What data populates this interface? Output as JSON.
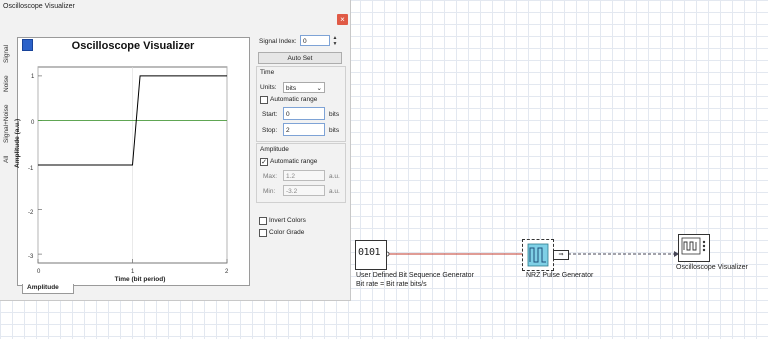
{
  "window": {
    "title": "Oscilloscope Visualizer",
    "close_glyph": "×"
  },
  "plot": {
    "title": "Oscilloscope Visualizer",
    "ylabel": "Amplitude (a.u.)",
    "xlabel": "Time (bit period)",
    "side_tabs": [
      "Signal",
      "Noise",
      "Signal+Noise",
      "All"
    ],
    "bottom_tab": "Amplitude",
    "yticks": [
      "1",
      "0",
      "-1",
      "-2",
      "-3"
    ],
    "xticks": [
      "0",
      "1",
      "2"
    ]
  },
  "chart_data": {
    "type": "line",
    "x": [
      0,
      1.0,
      1.08,
      2
    ],
    "y": [
      -1,
      -1,
      1,
      1
    ],
    "ylim": [
      -3.2,
      1.2
    ],
    "xlim": [
      0,
      2
    ],
    "title": "Oscilloscope Visualizer",
    "xlabel": "Time (bit period)",
    "ylabel": "Amplitude (a.u.)",
    "color": "#000000",
    "zero_line_color": "#4a9a3c"
  },
  "controls": {
    "signal_index_label": "Signal Index:",
    "signal_index_value": "0",
    "auto_set_label": "Auto Set",
    "time_group": "Time",
    "units_label": "Units:",
    "units_value": "bits",
    "automatic_range_label": "Automatic range",
    "start_label": "Start:",
    "start_value": "0",
    "start_unit": "bits",
    "stop_label": "Stop:",
    "stop_value": "2",
    "stop_unit": "bits",
    "amplitude_group": "Amplitude",
    "amp_automatic_range_label": "Automatic range",
    "max_label": "Max:",
    "max_value": "1.2",
    "max_unit": "a.u.",
    "min_label": "Min:",
    "min_value": "-3.2",
    "min_unit": "a.u.",
    "invert_colors_label": "Invert Colors",
    "color_grade_label": "Color Grade"
  },
  "canvas": {
    "bit_gen": {
      "label": "User Defined Bit Sequence Generator",
      "sub": "Bit rate = Bit rate  bits/s",
      "glyph": "0101"
    },
    "nrz": {
      "label": "NRZ Pulse Generator"
    },
    "scope": {
      "label": "Oscilloscope Visualizer"
    }
  }
}
